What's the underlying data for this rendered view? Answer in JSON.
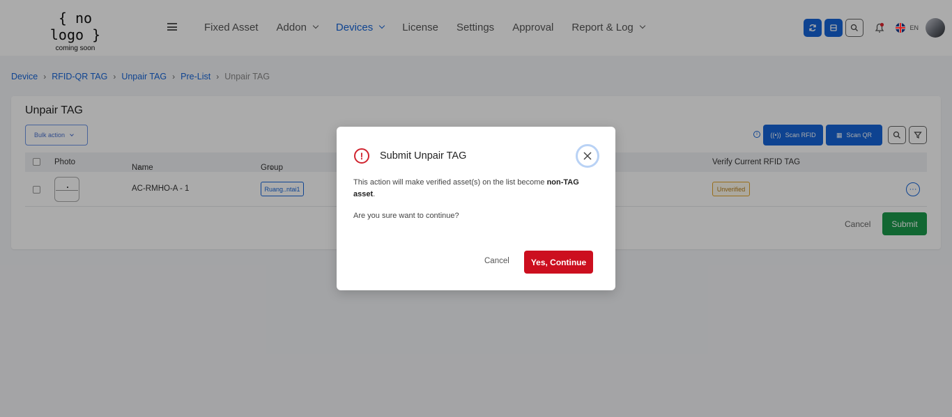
{
  "logo": {
    "main": "{ no logo }",
    "sub": "coming soon"
  },
  "nav": {
    "items": [
      {
        "label": "Fixed Asset",
        "dropdown": false,
        "active": false
      },
      {
        "label": "Addon",
        "dropdown": true,
        "active": false
      },
      {
        "label": "Devices",
        "dropdown": true,
        "active": true
      },
      {
        "label": "License",
        "dropdown": false,
        "active": false
      },
      {
        "label": "Settings",
        "dropdown": false,
        "active": false
      },
      {
        "label": "Approval",
        "dropdown": false,
        "active": false
      },
      {
        "label": "Report & Log",
        "dropdown": true,
        "active": false
      }
    ],
    "lang": "EN"
  },
  "breadcrumb": [
    "Device",
    "RFID-QR TAG",
    "Unpair TAG",
    "Pre-List",
    "Unpair TAG"
  ],
  "card": {
    "title": "Unpair TAG",
    "bulk_action": "Bulk action",
    "scan_rfid": "Scan RFID",
    "scan_qr": "Scan QR",
    "columns": {
      "photo": "Photo",
      "name": "Name",
      "group": "Group",
      "verify": "Verify Current RFID TAG"
    },
    "rows": [
      {
        "name": "AC-RMHO-A - 1",
        "group": "Ruang..ntai1",
        "verify": "Unverified"
      }
    ],
    "cancel": "Cancel",
    "submit": "Submit"
  },
  "modal": {
    "title": "Submit Unpair TAG",
    "message_pre": "This action will make verified asset(s) on the list become ",
    "message_bold1": "non-TAG",
    "message_bold2": "asset",
    "message_post": ".",
    "question": "Are you sure want to continue?",
    "cancel": "Cancel",
    "confirm": "Yes, Continue"
  },
  "colors": {
    "primary": "#1565d8",
    "danger": "#cc0f1f",
    "success": "#1a9a4b",
    "warning": "#e3a326"
  }
}
